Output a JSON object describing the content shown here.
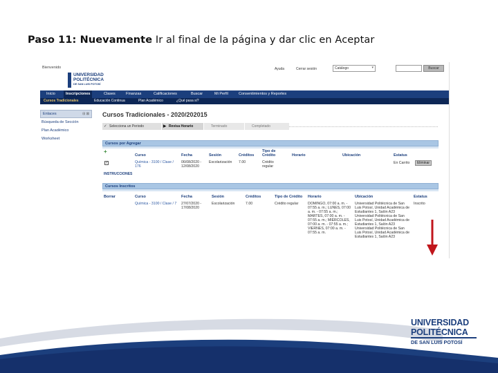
{
  "slide": {
    "title_bold": "Paso 11: Nuevamente",
    "title_rest": " Ir al final de la página y dar clic en Aceptar"
  },
  "header": {
    "welcome": "Bienvenido",
    "logo_line1": "UNIVERSIDAD",
    "logo_line2": "POLITÉCNICA",
    "logo_line3": "DE SAN LUIS POTOSÍ",
    "help": "Ayuda",
    "logout": "Cerrar sesión",
    "catalog_value": "Catálogo",
    "search_button": "Buscar"
  },
  "nav": {
    "tabs": [
      "Inicio",
      "Inscripciones",
      "Clases",
      "Finanzas",
      "Calificaciones",
      "Buscar",
      "Mi Perfil",
      "Consentimientos y Reportes"
    ],
    "active": "Inscripciones"
  },
  "subnav": {
    "tabs": [
      "Cursos Tradicionales",
      "Educación Continua",
      "Plan Académico",
      "¿Qué pasa si?"
    ],
    "active": "Cursos Tradicionales"
  },
  "sidebar": {
    "title": "Enlaces",
    "tools": "⊟ ⊠",
    "items": [
      "Búsqueda de Sección",
      "Plan Académico",
      "Worksheet"
    ]
  },
  "page": {
    "title": "Cursos Tradicionales - 2020/202015"
  },
  "wizard": {
    "steps": [
      "Selecciona un Periodo",
      "Revisa Horario",
      "Terminado",
      "Completado"
    ]
  },
  "to_add": {
    "title": "Cursos por Agregar",
    "columns": [
      "Curso",
      "Fecha",
      "Sesión",
      "Créditos",
      "Tipo de Crédito",
      "Horario",
      "Ubicación",
      "Estatus"
    ],
    "row": {
      "course": "Química - 3100 / Clase / 176",
      "date": "06/08/2020 - 12/08/2020",
      "session": "Escolarización",
      "credits": "7.00",
      "credit_type": "Crédito regular",
      "status": "En Carrito",
      "delete": "Eliminar"
    },
    "instructions": "INSTRUCCIONES"
  },
  "enrolled": {
    "title": "Cursos Inscritos",
    "columns": [
      "Borrar",
      "Curso",
      "Fecha",
      "Sesión",
      "Créditos",
      "Tipo de Crédito",
      "Horario",
      "Ubicación",
      "Estatus"
    ],
    "row": {
      "course": "Química - 3100 / Clase / 7",
      "date": "27/07/2020 - 17/08/2020",
      "session": "Escolarización",
      "credits": "7.00",
      "credit_type": "Crédito regular",
      "schedule": "DOMINGO, 07:00 a. m. - 07:55 a. m.; LUNES, 07:00 a. m. - 07:55 a. m.; MARTES, 07:00 a. m. - 07:55 a. m.; MIÉRCOLES, 07:00 a. m. - 07:55 a. m.; VIERNES, 07:00 a. m. - 07:55 a. m.",
      "location": "Universidad Politécnica de San Luis Potosí, Unidad Académica de Estudiantes 1, Salón A23 Universidad Politécnica de San Luis Potosí, Unidad Académica de Estudiantes 1, Salón A23 Universidad Politécnica de San Luis Potosí, Unidad Académica de Estudiantes 1, Salón A23",
      "status": "Inscrito"
    }
  },
  "footer_logo": {
    "line1": "UNIVERSIDAD",
    "line2": "POLITÉCNICA",
    "line3": "DE SAN LUIS POTOSÍ"
  },
  "colors": {
    "brand_navy": "#1c3f7d",
    "nav_dark": "#0d2756",
    "arrow_red": "#c0161c"
  }
}
